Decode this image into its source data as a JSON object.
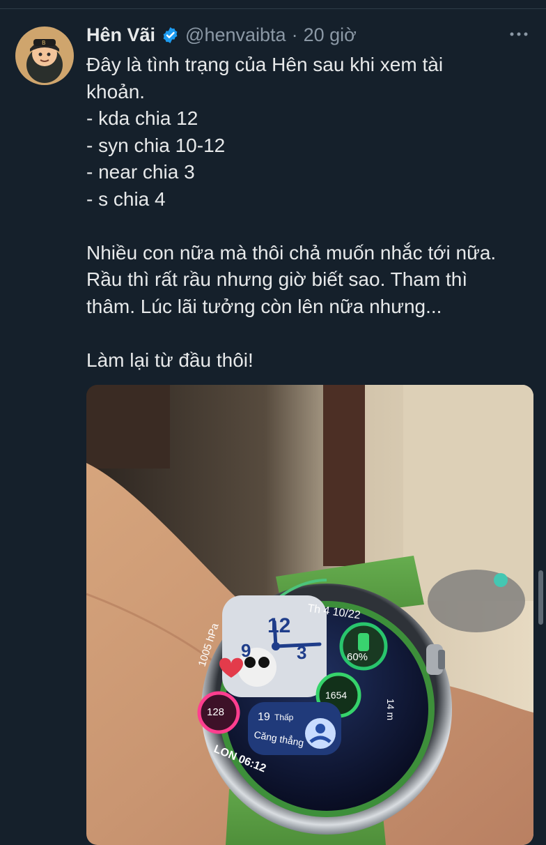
{
  "tweet": {
    "author_name": "Hên Vãi",
    "handle": "@henvaibta",
    "separator": "·",
    "time": "20 giờ",
    "text_lines": [
      "Đây là tình trạng của Hên sau khi xem tài",
      "khoản.",
      "- kda chia 12",
      "- syn chia 10-12",
      "- near chia 3",
      "- s chia 4",
      "",
      "Nhiều con nữa mà thôi chả muốn nhắc tới nữa.",
      "Rầu thì rất rầu nhưng giờ biết sao. Tham thì",
      "thâm. Lúc lãi tưởng còn lên nữa nhưng...",
      "",
      "Làm lại từ đầu thôi!"
    ],
    "icons": {
      "verified": "verified-badge-icon",
      "more": "more-options-icon",
      "avatar": "avatar-cartoon-boy"
    },
    "colors": {
      "background": "#15202b",
      "text": "#e7e9ea",
      "muted": "#8b98a5",
      "verified": "#1d9bf0"
    }
  },
  "watch_face": {
    "date": "Th 4 10/22",
    "big_hour": "12",
    "left_digit": "9",
    "right_digit": "3",
    "pressure": "1005 hPa",
    "battery": "60%",
    "steps": "1654",
    "distance": "14 m",
    "heart_rate": "128",
    "stress_value": "19",
    "stress_level": "Thấp",
    "stress_label": "Căng thẳng",
    "world_clock": "LON 06:12"
  }
}
